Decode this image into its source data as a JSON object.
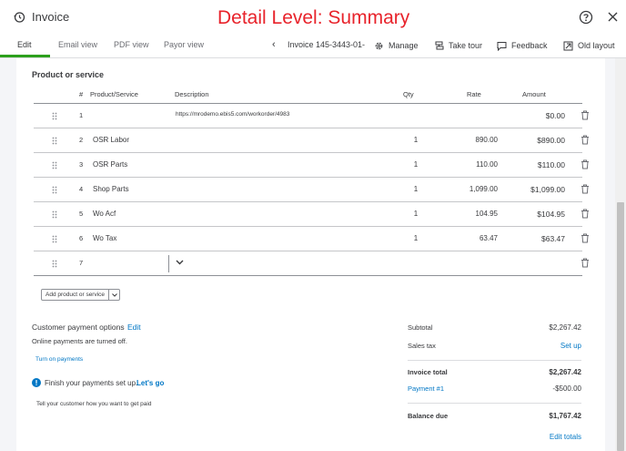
{
  "header": {
    "title": "Invoice",
    "annotation": "Detail Level: Summary"
  },
  "tabs": [
    {
      "label": "Edit"
    },
    {
      "label": "Email view"
    },
    {
      "label": "PDF view"
    },
    {
      "label": "Payor view"
    }
  ],
  "toolbar": {
    "invoice_number": "Invoice 145-3443-01-",
    "manage": "Manage",
    "take_tour": "Take tour",
    "feedback": "Feedback",
    "old_layout": "Old layout"
  },
  "section": {
    "title": "Product or service"
  },
  "table": {
    "columns": [
      "#",
      "Product/Service",
      "Description",
      "Qty",
      "Rate",
      "Amount"
    ],
    "rows": [
      {
        "num": "1",
        "product": "",
        "description": "https://mrodemo.ebis5.com/workorder/4983",
        "qty": "",
        "rate": "",
        "amount": "$0.00"
      },
      {
        "num": "2",
        "product": "OSR Labor",
        "description": "",
        "qty": "1",
        "rate": "890.00",
        "amount": "$890.00"
      },
      {
        "num": "3",
        "product": "OSR Parts",
        "description": "",
        "qty": "1",
        "rate": "110.00",
        "amount": "$110.00"
      },
      {
        "num": "4",
        "product": "Shop Parts",
        "description": "",
        "qty": "1",
        "rate": "1,099.00",
        "amount": "$1,099.00"
      },
      {
        "num": "5",
        "product": "Wo Acf",
        "description": "",
        "qty": "1",
        "rate": "104.95",
        "amount": "$104.95"
      },
      {
        "num": "6",
        "product": "Wo Tax",
        "description": "",
        "qty": "1",
        "rate": "63.47",
        "amount": "$63.47"
      },
      {
        "num": "7",
        "product": "",
        "description": "",
        "qty": "",
        "rate": "",
        "amount": ""
      }
    ]
  },
  "add_button": {
    "label": "Add product or service"
  },
  "payment": {
    "title": "Customer payment options",
    "edit": "Edit",
    "status": "Online payments are turned off.",
    "turn_on": "Turn on payments",
    "finish": "Finish your payments set up.",
    "lets_go": "Let's go",
    "tell": "Tell your customer how you want to get paid"
  },
  "totals": {
    "subtotal_label": "Subtotal",
    "subtotal_value": "$2,267.42",
    "sales_tax_label": "Sales tax",
    "sales_tax_link": "Set up",
    "invoice_total_label": "Invoice total",
    "invoice_total_value": "$2,267.42",
    "payment_label": "Payment #1",
    "payment_value": "-$500.00",
    "balance_label": "Balance due",
    "balance_value": "$1,767.42",
    "edit_totals": "Edit totals"
  },
  "colors": {
    "accent": "#2ca01c",
    "link": "#0077c5",
    "annotation": "#e8232b"
  },
  "icons": [
    "history-icon",
    "help-icon",
    "close-icon",
    "gear-icon",
    "tour-icon",
    "feedback-icon",
    "old-layout-icon",
    "drag-handle-icon",
    "trash-icon",
    "chevron-down-icon",
    "info-icon"
  ]
}
